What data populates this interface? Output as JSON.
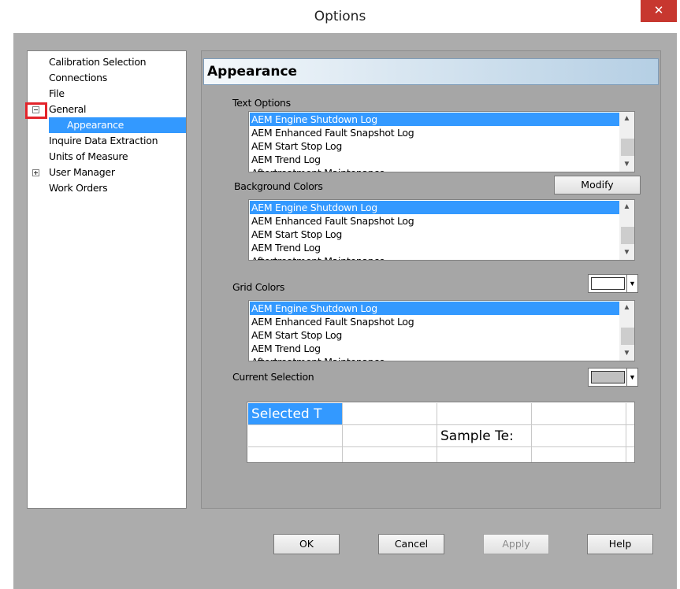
{
  "window": {
    "title": "Options",
    "close_glyph": "✕"
  },
  "tree": {
    "items": [
      {
        "label": "Calibration Selection"
      },
      {
        "label": "Connections"
      },
      {
        "label": "File"
      },
      {
        "label": "General",
        "expander": "minus"
      },
      {
        "label": "Appearance",
        "selected": true
      },
      {
        "label": "Inquire Data Extraction"
      },
      {
        "label": "Units of Measure"
      },
      {
        "label": "User Manager",
        "expander": "plus"
      },
      {
        "label": "Work Orders"
      }
    ]
  },
  "panel": {
    "title": "Appearance",
    "text_options": {
      "label": "Text Options",
      "items": [
        "AEM Engine Shutdown Log",
        "AEM Enhanced Fault Snapshot Log",
        "AEM Start Stop Log",
        "AEM Trend Log",
        "Aftertreatment Maintenance"
      ],
      "selected_index": 0
    },
    "background_colors": {
      "label": "Background Colors",
      "modify_label": "Modify",
      "items": [
        "AEM Engine Shutdown Log",
        "AEM Enhanced Fault Snapshot Log",
        "AEM Start Stop Log",
        "AEM Trend Log",
        "Aftertreatment Maintenance"
      ],
      "selected_index": 0
    },
    "grid_colors": {
      "label": "Grid Colors",
      "swatch_color": "#ffffff",
      "items": [
        "AEM Engine Shutdown Log",
        "AEM Enhanced Fault Snapshot Log",
        "AEM Start Stop Log",
        "AEM Trend Log",
        "Aftertreatment Maintenance"
      ],
      "selected_index": 0
    },
    "current_selection": {
      "label": "Current Selection",
      "swatch_color": "#c0c0c0"
    },
    "preview": {
      "selected_text": "Selected T",
      "sample_text": "Sample Te:"
    }
  },
  "buttons": {
    "ok": "OK",
    "cancel": "Cancel",
    "apply": "Apply",
    "help": "Help"
  },
  "colors": {
    "selection": "#3399ff",
    "close_red": "#c7372f",
    "dialog_bg": "#acacac",
    "highlight_red": "#e3242b"
  }
}
